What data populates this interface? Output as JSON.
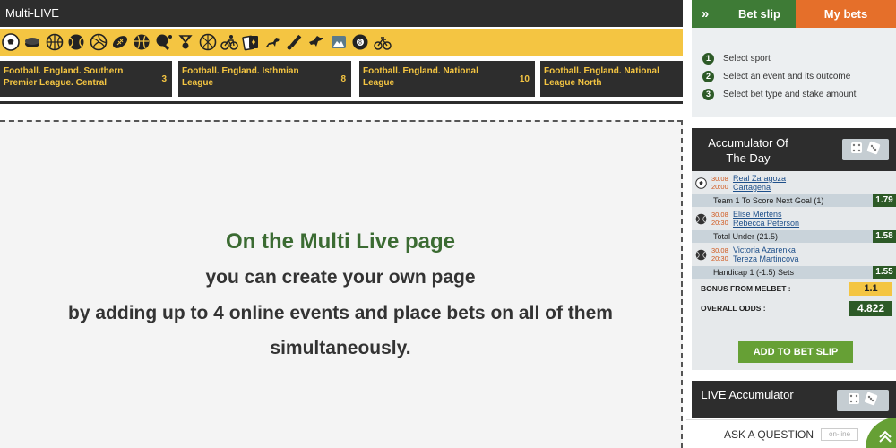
{
  "multilive": {
    "title": "Multi-LIVE",
    "sport_icons": [
      "football-icon",
      "ice-hockey-icon",
      "basketball-icon",
      "tennis-icon",
      "volleyball-icon",
      "american-football-icon",
      "handball-icon",
      "table-tennis-icon",
      "badminton-icon",
      "futsal-icon",
      "cycling-icon",
      "cards-icon",
      "horse-racing-icon",
      "cricket-icon",
      "dog-racing-icon",
      "esports-icon",
      "billiards-icon",
      "bicycle-icon"
    ],
    "events": [
      {
        "name": "Football. England. Southern Premier League. Central",
        "count": "3"
      },
      {
        "name": "Football. England. Isthmian League",
        "count": "8"
      },
      {
        "name": "Football. England. National League",
        "count": "10"
      },
      {
        "name": "Football. England. National League North",
        "count": ""
      }
    ],
    "placeholder": {
      "title": "On the Multi Live page",
      "line1": "you can create your own page",
      "line2": "by adding up to 4 online events and place bets on all of them",
      "line3": "simultaneously."
    }
  },
  "betslip": {
    "tab_betslip": "Bet slip",
    "tab_mybets": "My bets",
    "steps": [
      {
        "num": "1",
        "text": "Select sport"
      },
      {
        "num": "2",
        "text": "Select an event and its outcome"
      },
      {
        "num": "3",
        "text": "Select bet type and stake amount"
      }
    ]
  },
  "accumulator": {
    "title": "Accumulator Of The Day",
    "matches": [
      {
        "date": "30.08",
        "time": "20:00",
        "team1": "Real Zaragoza",
        "team2": "Cartagena",
        "market": "Team 1 To Score Next Goal (1)",
        "odd": "1.79",
        "sport_icon": "football-icon"
      },
      {
        "date": "30.08",
        "time": "20:30",
        "team1": "Elise Mertens",
        "team2": "Rebecca Peterson",
        "market": "Total Under (21.5)",
        "odd": "1.58",
        "sport_icon": "tennis-icon"
      },
      {
        "date": "30.08",
        "time": "20:30",
        "team1": "Victoria Azarenka",
        "team2": "Tereza Martincova",
        "market": "Handicap 1 (-1.5) Sets",
        "odd": "1.55",
        "sport_icon": "tennis-icon"
      }
    ],
    "bonus_label": "BONUS FROM MELBET :",
    "bonus_value": "1.1",
    "overall_label": "OVERALL ODDS :",
    "overall_value": "4.822",
    "add_button": "ADD TO BET SLIP"
  },
  "live_accumulator": {
    "title": "LIVE Accumulator"
  },
  "support": {
    "ask_label": "ASK A QUESTION",
    "status": "on-line"
  },
  "colors": {
    "dark": "#2d2d2d",
    "yellow": "#f4c542",
    "green": "#3e7b36",
    "orange": "#e56f2a"
  }
}
